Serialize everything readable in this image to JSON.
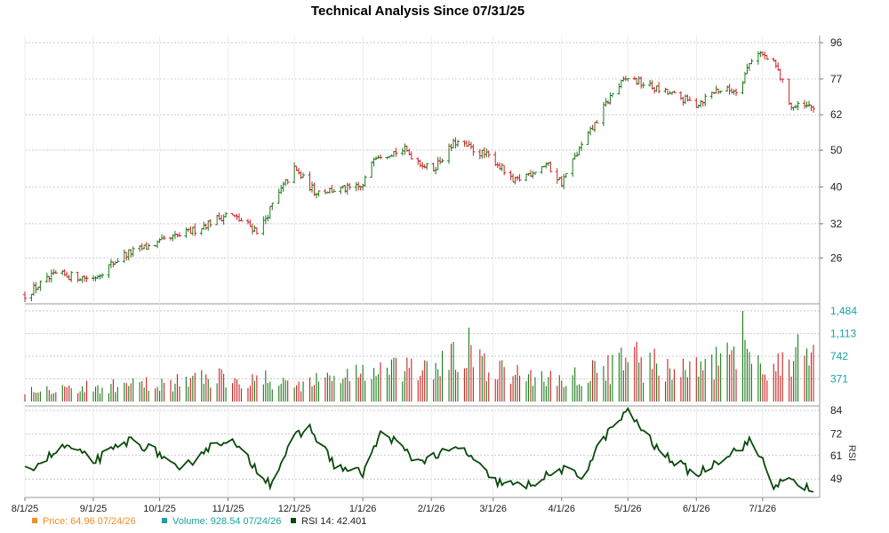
{
  "chart_data": {
    "type": "ohlc",
    "title": "Technical Analysis Since 07/31/25",
    "x_ticks": [
      "8/1/25",
      "9/1/25",
      "10/1/25",
      "11/1/25",
      "12/1/25",
      "1/1/26",
      "2/1/26",
      "3/1/26",
      "4/1/26",
      "5/1/26",
      "6/1/26",
      "7/1/26"
    ],
    "price_axis": {
      "scale": "log",
      "ticks": [
        "26",
        "32",
        "40",
        "50",
        "62",
        "77",
        "96"
      ]
    },
    "volume_axis": {
      "ticks": [
        "371",
        "742",
        "1,113",
        "1,484"
      ],
      "ylim": [
        0,
        1484
      ]
    },
    "rsi_axis": {
      "label": "RSI",
      "ticks": [
        "49",
        "61",
        "72",
        "84"
      ]
    },
    "price_key": [
      [
        "2025-08-01",
        20.8
      ],
      [
        "2025-08-15",
        23.5
      ],
      [
        "2025-09-01",
        23.0
      ],
      [
        "2025-09-15",
        26.5
      ],
      [
        "2025-10-01",
        28.5
      ],
      [
        "2025-10-15",
        30.5
      ],
      [
        "2025-11-01",
        34.0
      ],
      [
        "2025-11-15",
        30.5
      ],
      [
        "2025-12-01",
        44.5
      ],
      [
        "2025-12-10",
        39.0
      ],
      [
        "2025-12-25",
        39.5
      ],
      [
        "2026-01-01",
        40.0
      ],
      [
        "2026-01-06",
        48.5
      ],
      [
        "2026-01-20",
        50.0
      ],
      [
        "2026-02-01",
        44.0
      ],
      [
        "2026-02-12",
        52.5
      ],
      [
        "2026-03-01",
        47.5
      ],
      [
        "2026-03-10",
        41.0
      ],
      [
        "2026-03-25",
        46.0
      ],
      [
        "2026-04-01",
        41.0
      ],
      [
        "2026-04-15",
        57.0
      ],
      [
        "2026-04-25",
        72.0
      ],
      [
        "2026-05-01",
        77.5
      ],
      [
        "2026-05-15",
        72.0
      ],
      [
        "2026-06-01",
        66.0
      ],
      [
        "2026-06-10",
        72.0
      ],
      [
        "2026-06-20",
        72.0
      ],
      [
        "2026-06-28",
        92.0
      ],
      [
        "2026-07-07",
        83.0
      ],
      [
        "2026-07-14",
        65.0
      ],
      [
        "2026-07-24",
        64.96
      ]
    ],
    "volume_key": [
      [
        "2025-08-01",
        220
      ],
      [
        "2025-09-01",
        230
      ],
      [
        "2025-10-01",
        290
      ],
      [
        "2025-11-01",
        420
      ],
      [
        "2025-12-01",
        280
      ],
      [
        "2026-01-01",
        480
      ],
      [
        "2026-02-01",
        500
      ],
      [
        "2026-02-15",
        760
      ],
      [
        "2026-03-01",
        480
      ],
      [
        "2026-04-01",
        350
      ],
      [
        "2026-05-01",
        640
      ],
      [
        "2026-06-01",
        500
      ],
      [
        "2026-06-20",
        720
      ],
      [
        "2026-07-07",
        600
      ],
      [
        "2026-07-24",
        928.54
      ]
    ],
    "volume_spikes": [
      [
        "2025-11-01",
        880
      ],
      [
        "2025-10-25",
        820
      ],
      [
        "2026-02-18",
        1210
      ],
      [
        "2026-01-10",
        820
      ],
      [
        "2026-02-08",
        850
      ],
      [
        "2026-05-05",
        980
      ],
      [
        "2026-04-22",
        760
      ],
      [
        "2026-06-22",
        1484
      ],
      [
        "2026-06-18",
        900
      ],
      [
        "2026-07-24",
        928.54
      ]
    ],
    "rsi_key": [
      [
        "2025-08-01",
        53
      ],
      [
        "2025-08-20",
        66
      ],
      [
        "2025-09-01",
        58
      ],
      [
        "2025-09-18",
        69
      ],
      [
        "2025-10-01",
        62
      ],
      [
        "2025-10-10",
        52
      ],
      [
        "2025-10-20",
        63
      ],
      [
        "2025-11-01",
        70
      ],
      [
        "2025-11-20",
        47
      ],
      [
        "2025-12-01",
        70
      ],
      [
        "2025-12-08",
        75
      ],
      [
        "2025-12-20",
        55
      ],
      [
        "2026-01-01",
        52
      ],
      [
        "2026-01-10",
        74
      ],
      [
        "2026-01-25",
        58
      ],
      [
        "2026-02-15",
        65
      ],
      [
        "2026-03-01",
        48
      ],
      [
        "2026-03-15",
        45
      ],
      [
        "2026-04-01",
        54
      ],
      [
        "2026-04-10",
        50
      ],
      [
        "2026-04-20",
        70
      ],
      [
        "2026-05-01",
        84
      ],
      [
        "2026-05-15",
        63
      ],
      [
        "2026-06-01",
        51
      ],
      [
        "2026-06-10",
        58
      ],
      [
        "2026-06-25",
        68
      ],
      [
        "2026-07-01",
        59
      ],
      [
        "2026-07-05",
        46
      ],
      [
        "2026-07-15",
        48
      ],
      [
        "2026-07-24",
        42.401
      ]
    ],
    "legend": [
      {
        "name": "Price",
        "value": "64.96",
        "date": "07/24/26",
        "color": "#f28c28"
      },
      {
        "name": "Volume",
        "value": "928.54",
        "date": "07/24/26",
        "color": "#1aa1a1"
      },
      {
        "name": "RSI 14",
        "value": "42.401",
        "date": "",
        "color": "#0a4a0a"
      }
    ],
    "colors": {
      "up": "#1a7a1a",
      "down": "#cc2222",
      "rsi": "#0a4a0a",
      "grid": "#bbbbbb",
      "volume_axis": "#1aa1a1"
    },
    "legend_placement": "bottom-left",
    "grid": true
  }
}
